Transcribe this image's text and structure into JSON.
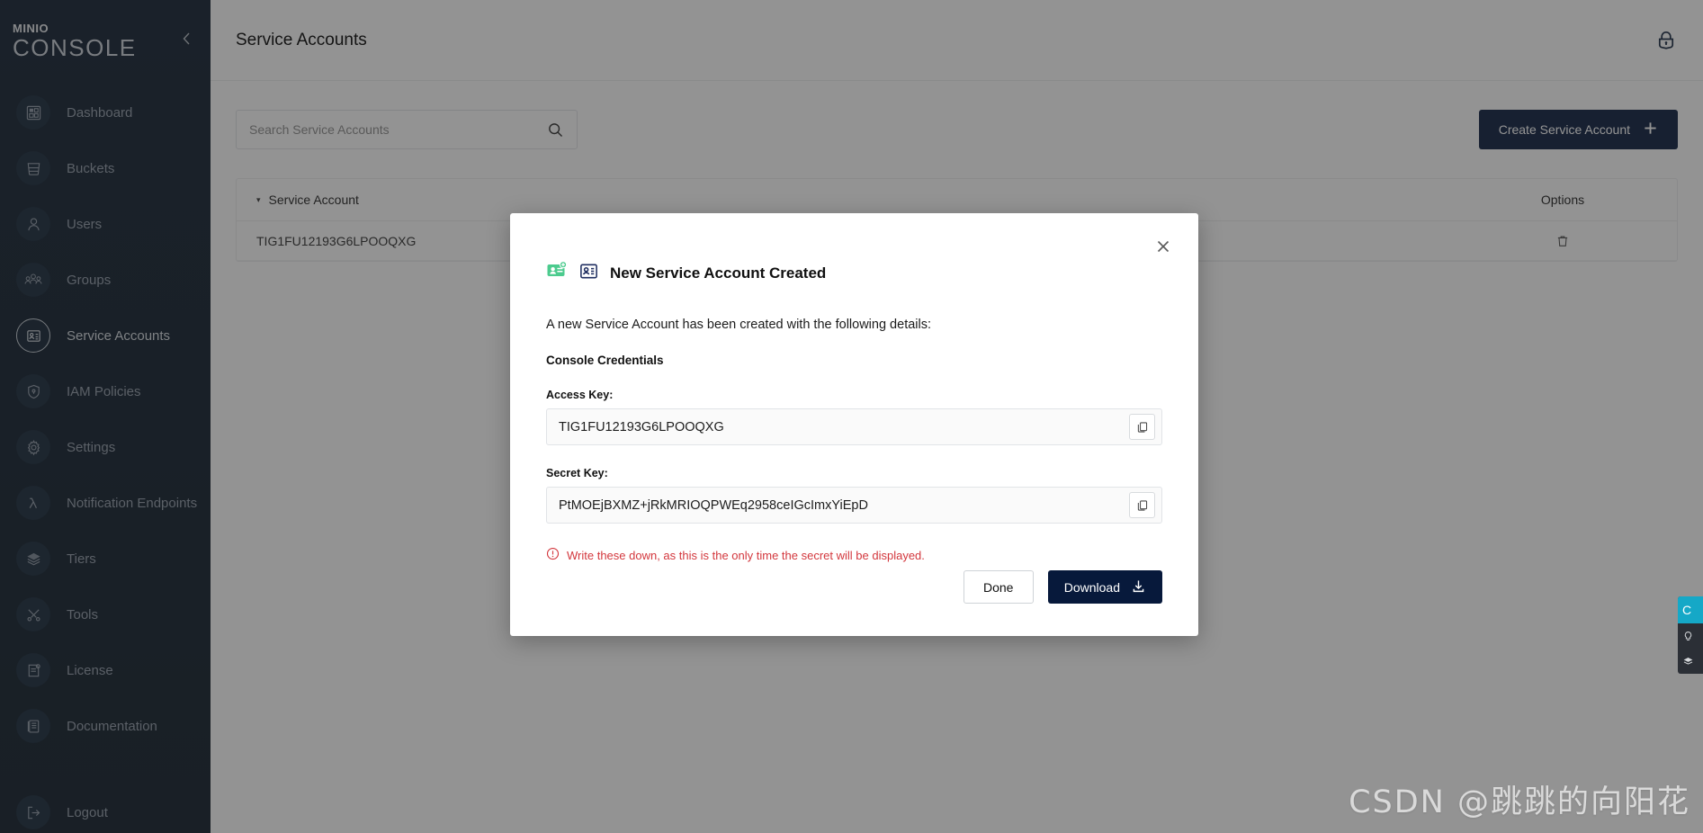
{
  "sidebar": {
    "brand_top": "MINIO",
    "brand_bottom": "CONSOLE",
    "collapse_icon": "chevron-left-icon",
    "items": [
      {
        "label": "Dashboard",
        "icon": "dashboard-icon",
        "active": false
      },
      {
        "label": "Buckets",
        "icon": "bucket-icon",
        "active": false
      },
      {
        "label": "Users",
        "icon": "user-icon",
        "active": false
      },
      {
        "label": "Groups",
        "icon": "groups-icon",
        "active": false
      },
      {
        "label": "Service Accounts",
        "icon": "id-card-icon",
        "active": true
      },
      {
        "label": "IAM Policies",
        "icon": "shield-lock-icon",
        "active": false
      },
      {
        "label": "Settings",
        "icon": "gear-icon",
        "active": false
      },
      {
        "label": "Notification Endpoints",
        "icon": "lambda-icon",
        "active": false
      },
      {
        "label": "Tiers",
        "icon": "layers-icon",
        "active": false
      },
      {
        "label": "Tools",
        "icon": "tools-icon",
        "active": false
      },
      {
        "label": "License",
        "icon": "license-document-icon",
        "active": false
      },
      {
        "label": "Documentation",
        "icon": "documentation-book-icon",
        "active": false
      },
      {
        "label": "Logout",
        "icon": "logout-icon",
        "active": false
      }
    ]
  },
  "header": {
    "title": "Service Accounts",
    "lock_icon": "lock-icon"
  },
  "toolbar": {
    "search_placeholder": "Search Service Accounts",
    "search_value": "",
    "search_icon": "search-icon",
    "create_label": "Create Service Account",
    "create_icon": "plus-icon"
  },
  "table": {
    "columns": {
      "account": "Service Account",
      "options": "Options"
    },
    "sort_caret": "▾",
    "rows": [
      {
        "account": "TIG1FU12193G6LPOOQXG",
        "delete_icon": "trash-icon"
      }
    ]
  },
  "modal": {
    "icon_left": "add-service-account-icon",
    "icon_right": "id-card-icon",
    "title": "New Service Account Created",
    "description": "A new Service Account has been created with the following details:",
    "credentials_label": "Console Credentials",
    "close_icon": "close-icon",
    "fields": [
      {
        "label": "Access Key:",
        "value": "TIG1FU12193G6LPOOQXG",
        "copy_icon": "copy-icon"
      },
      {
        "label": "Secret Key:",
        "value": "PtMOEjBXMZ+jRkMRIOQPWEq2958ceIGcImxYiEpD",
        "copy_icon": "copy-icon"
      }
    ],
    "warning_icon": "warning-circle-icon",
    "warning_text": "Write these down, as this is the only time the secret will be displayed.",
    "done_label": "Done",
    "download_label": "Download",
    "download_icon": "download-icon"
  },
  "float_widget": {
    "head_label": "C",
    "icons": [
      "lightbulb-icon",
      "layers-icon"
    ]
  },
  "watermark": "CSDN @跳跳的向阳花",
  "colors": {
    "sidebar_bg": "#0b1929",
    "primary_dark": "#07193b",
    "accent_green": "#4ccb8e",
    "accent_navy": "#1f2e60",
    "warning_red": "#d3373d",
    "widget_cyan": "#15a8c7"
  }
}
